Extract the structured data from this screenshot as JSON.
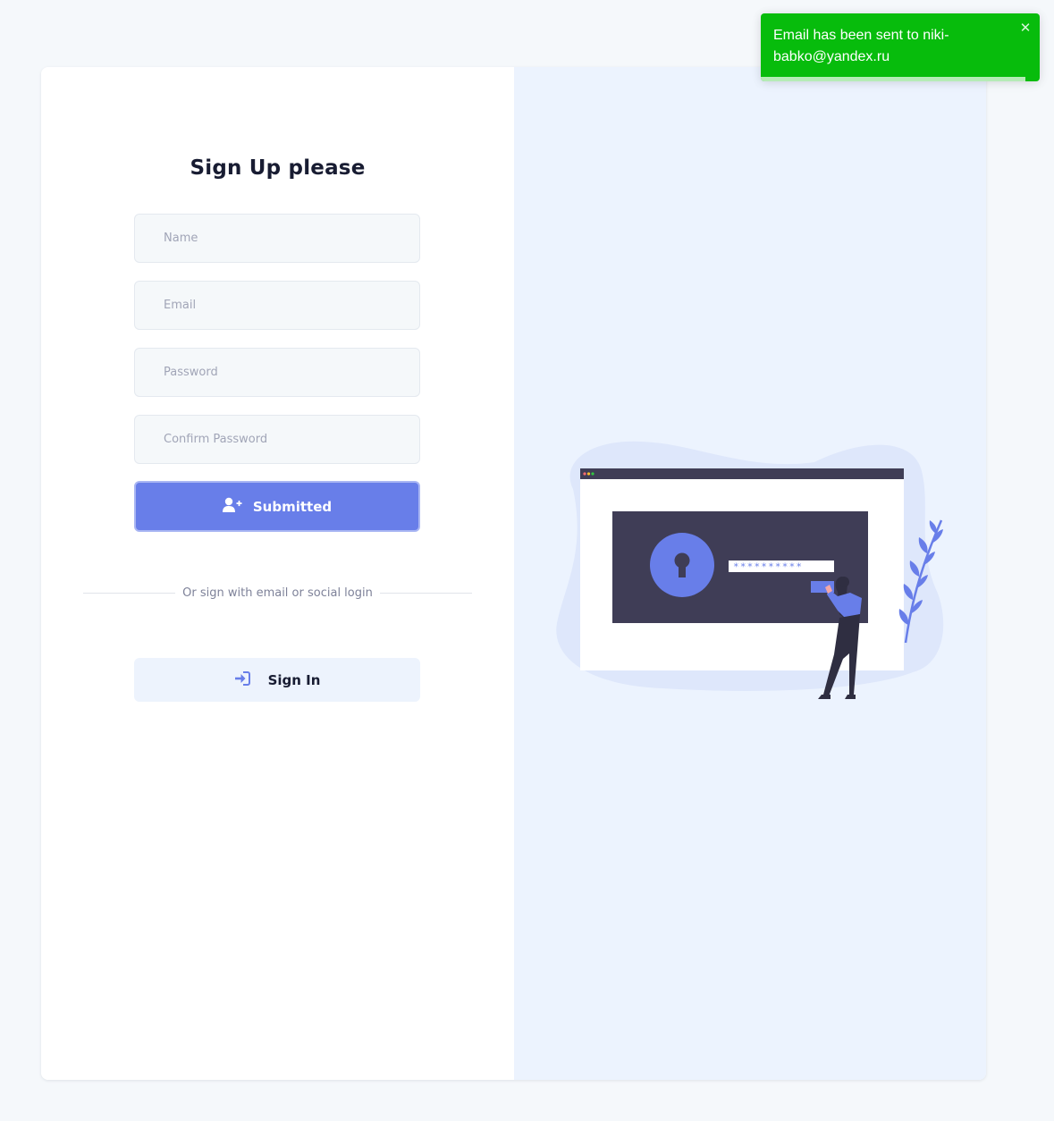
{
  "form": {
    "title": "Sign Up please",
    "name_placeholder": "Name",
    "email_placeholder": "Email",
    "password_placeholder": "Password",
    "confirm_placeholder": "Confirm Password",
    "submit_label": "Submitted",
    "divider_text": "Or sign with email or social login",
    "signin_label": "Sign In"
  },
  "illustration": {
    "password_mask": "**********"
  },
  "toast": {
    "message": "Email has been sent to niki-babko@yandex.ru",
    "close_glyph": "✕",
    "progress": 0.95
  },
  "colors": {
    "accent": "#687ee9",
    "toast_success": "#07bc0c",
    "panel_bg": "#ecf3fe"
  },
  "icons": {
    "submit": "user-plus-icon",
    "signin": "sign-in-icon",
    "close": "close-icon"
  }
}
